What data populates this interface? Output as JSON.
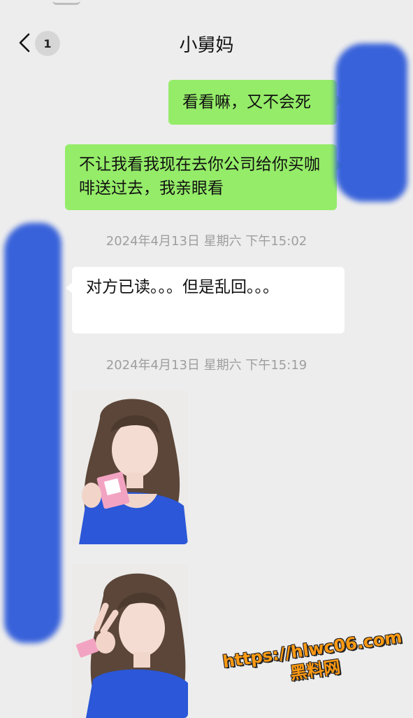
{
  "header": {
    "title": "小舅妈",
    "unread_count": "1",
    "back_icon": "chevron-left-icon"
  },
  "messages": [
    {
      "type": "sent",
      "text": "看看嘛，又不会死"
    },
    {
      "type": "sent",
      "text": "不让我看我现在去你公司给你买咖啡送过去，我亲眼看"
    },
    {
      "type": "time",
      "text": "2024年4月13日 星期六 下午15:02"
    },
    {
      "type": "received",
      "text": "对方已读。。。但是乱回。。。"
    },
    {
      "type": "time",
      "text": "2024年4月13日 星期六 下午15:19"
    },
    {
      "type": "image"
    },
    {
      "type": "image"
    }
  ],
  "watermark": {
    "url": "https://hlwc06.com",
    "name": "黑料网"
  },
  "colors": {
    "background": "#ededed",
    "sent_bubble": "#95ec69",
    "received_bubble": "#ffffff",
    "redaction": "#2f5bd9",
    "watermark": "#ff9a12"
  }
}
